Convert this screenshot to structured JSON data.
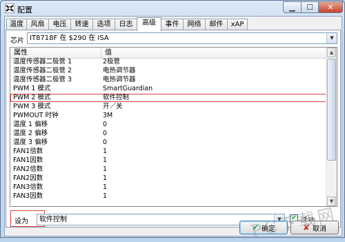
{
  "window": {
    "title": "配置",
    "controls": {
      "minimize": "▁",
      "maximize": "☐",
      "close": "✕"
    },
    "colors": {
      "frame": "#c3d8ef",
      "accent": "#3c7fb1",
      "highlight": "#e04040"
    }
  },
  "tabs": [
    {
      "label": "温度"
    },
    {
      "label": "风扇"
    },
    {
      "label": "电压"
    },
    {
      "label": "转速"
    },
    {
      "label": "选项"
    },
    {
      "label": "日志"
    },
    {
      "label": "高级"
    },
    {
      "label": "事件"
    },
    {
      "label": "网络"
    },
    {
      "label": "邮件"
    },
    {
      "label": "xAP"
    }
  ],
  "active_tab": "高级",
  "chip": {
    "label": "芯片",
    "value": "IT8718F 在 $290 在 ISA"
  },
  "list": {
    "columns": {
      "property": "属性",
      "value": "值"
    },
    "rows": [
      {
        "k": "温度传感器二极管 1",
        "v": "2极管"
      },
      {
        "k": "温度传感器二极管 2",
        "v": "电热调节器"
      },
      {
        "k": "温度传感器二极管 3",
        "v": "电热调节器"
      },
      {
        "k": "PWM 1 模式",
        "v": "SmartGuardian"
      },
      {
        "k": "PWM 2 模式",
        "v": "软件控制"
      },
      {
        "k": "PWM 3 模式",
        "v": "开／关"
      },
      {
        "k": "PWMOUT 时钟",
        "v": "3M"
      },
      {
        "k": "温度 1 偏移",
        "v": "0"
      },
      {
        "k": "温度 2 偏移",
        "v": "0"
      },
      {
        "k": "温度 3 偏移",
        "v": "0"
      },
      {
        "k": "FAN1倍数",
        "v": "1"
      },
      {
        "k": "FAN1因数",
        "v": "1"
      },
      {
        "k": "FAN2倍数",
        "v": "1"
      },
      {
        "k": "FAN2因数",
        "v": "1"
      },
      {
        "k": "FAN3倍数",
        "v": "1"
      },
      {
        "k": "FAN3因数",
        "v": "1"
      }
    ],
    "selected_index": 4
  },
  "setting": {
    "label": "设为",
    "value": "软件控制",
    "checkbox_label": "活动",
    "checkbox_checked": true
  },
  "buttons": {
    "ok": "确定",
    "cancel": "取消"
  },
  "watermark": "PC下载网"
}
